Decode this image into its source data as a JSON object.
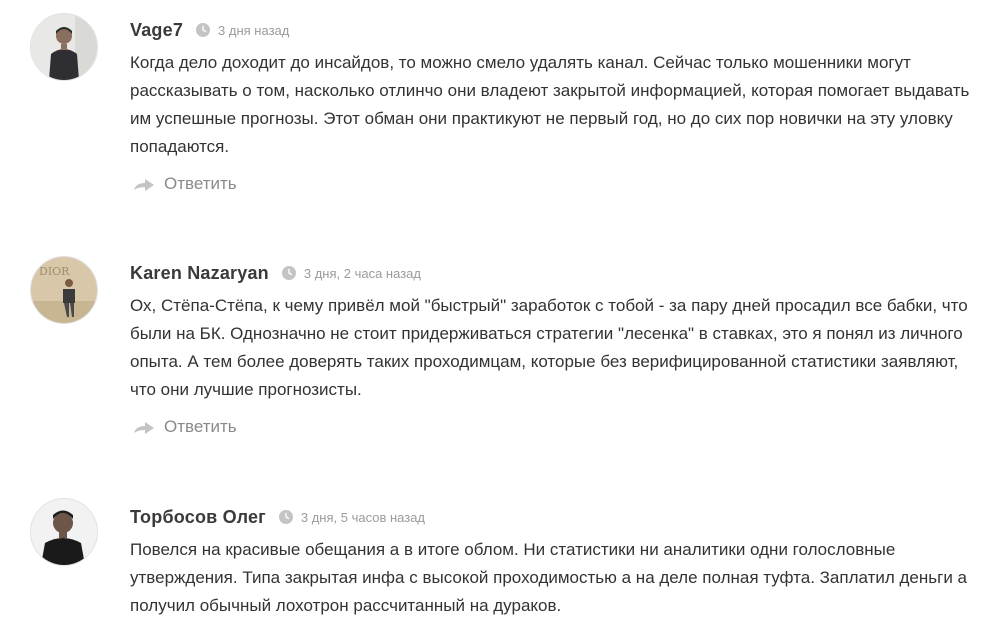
{
  "comments": [
    {
      "author": "Vage7",
      "time": "3 дня назад",
      "text": "Когда дело доходит до инсайдов, то можно смело удалять канал. Сейчас только мошенники могут рассказывать о том, насколько отлинчо они владеют закрытой информацией, которая помогает выдавать им успешные прогнозы. Этот обман они практикуют не первый год, но до сих пор новички на эту уловку попадаются.",
      "reply_label": "Ответить"
    },
    {
      "author": "Karen Nazaryan",
      "time": "3 дня, 2 часа назад",
      "text": "Ох, Стёпа-Стёпа, к чему привёл мой \"быстрый\" заработок с тобой - за пару дней просадил все бабки, что были на БК. Однозначно не стоит придерживаться стратегии \"лесенка\" в ставках, это я понял из личного опыта. А тем более доверять таких проходимцам, которые без верифицированной статистики заявляют, что они лучшие прогнозисты.",
      "reply_label": "Ответить",
      "avatar_text": "DIOR"
    },
    {
      "author": "Торбосов Олег",
      "time": "3 дня, 5 часов назад",
      "text": "Повелся на красивые обещания а в итоге облом. Ни статистики ни аналитики одни голословные утверждения. Типа закрытая инфа с высокой проходимостью а на деле полная туфта. Заплатил деньги а получил обычный лохотрон рассчитанный на дураков."
    }
  ],
  "icons": {
    "clock": "clock-icon",
    "reply": "reply-arrow-icon"
  },
  "colors": {
    "author": "#3a3a3a",
    "text": "#333333",
    "meta": "#9b9b9b",
    "reply": "#8a8a8a",
    "icon": "#c4c4c4"
  }
}
